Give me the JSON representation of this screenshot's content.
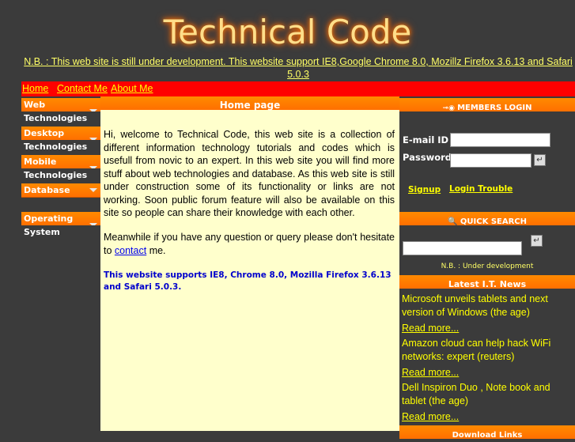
{
  "header": {
    "title": "Technical Code",
    "notice": "N.B. : This web site is still under development. This website support IE8,Google Chrome 8.0, Mozillz Firefox 3.6.13 and Safari 5.0.3"
  },
  "nav": {
    "items": [
      "Home",
      "Contact Me",
      "About Me"
    ]
  },
  "sidebar": {
    "sections": [
      {
        "head": "Web",
        "sub": "Technologies"
      },
      {
        "head": "Desktop",
        "sub": "Technologies"
      },
      {
        "head": "Mobile",
        "sub": "Technologies"
      },
      {
        "head": "Database",
        "sub": ""
      },
      {
        "head": "Operating",
        "sub": "System"
      }
    ]
  },
  "content": {
    "heading": "Home page",
    "para1": "Hi, welcome to Technical Code, this web site is a collection of different information technology tutorials and codes which is usefull from novic to an expert. In this web site you will find more stuff about web technologies and database. As this web site is still under construction some of its functionality or links are not working. Soon public forum feature will also be available on this site so people can share their knowledge with each other.",
    "para2_before": "Meanwhile if you have any question or query please don't hesitate to ",
    "para2_link": "contact",
    "para2_after": " me.",
    "para3": "This website supports IE8, Chrome 8.0, Mozilla Firefox 3.6.13 and Safari 5.0.3."
  },
  "login": {
    "heading": "MEMBERS LOGIN",
    "email_label": "E-mail ID",
    "password_label": "Password",
    "signup": "Signup",
    "trouble": "Login Trouble"
  },
  "search": {
    "heading": "QUICK SEARCH",
    "note": "N.B. : Under development"
  },
  "news": {
    "heading": "Latest I.T. News",
    "items": [
      {
        "text": "Microsoft unveils tablets and next version of Windows (the age)",
        "more": "Read more..."
      },
      {
        "text": "Amazon cloud can help hack WiFi networks: expert (reuters)",
        "more": "Read more..."
      },
      {
        "text": "Dell Inspiron Duo , Note book and tablet (the age)",
        "more": "Read more..."
      }
    ]
  },
  "downloads": {
    "heading": "Download Links"
  },
  "colors": {
    "accent": "#ff7a00",
    "nav_bg": "#ff0000",
    "link": "#ffff00",
    "content_bg": "#ffffcc"
  }
}
